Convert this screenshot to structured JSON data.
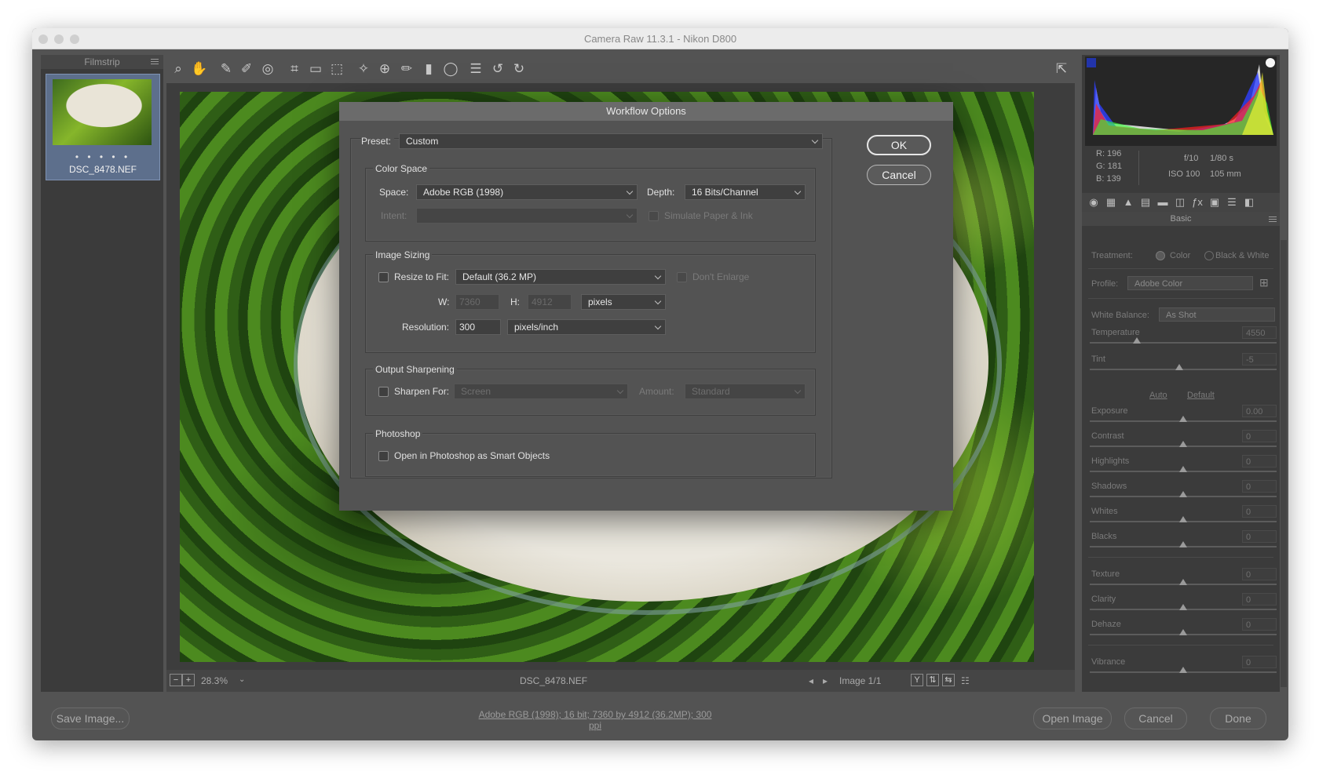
{
  "window": {
    "title": "Camera Raw 11.3.1  -  Nikon D800"
  },
  "filmstrip": {
    "header": "Filmstrip",
    "rating_dots": "• • • • •",
    "file_name": "DSC_8478.NEF"
  },
  "toolbar": {
    "tools": [
      "zoom-icon",
      "hand-icon",
      "white-balance-icon",
      "color-sampler-icon",
      "targeted-adjustment-icon",
      "crop-icon",
      "straighten-icon",
      "transform-icon",
      "spot-removal-icon",
      "red-eye-icon",
      "adjustment-brush-icon",
      "graduated-filter-icon",
      "radial-filter-icon",
      "presets-list-icon",
      "rotate-left-icon",
      "rotate-right-icon"
    ],
    "glyphs": [
      "⌕",
      "✋",
      "✎",
      "✐",
      "◎",
      "⌗",
      "▭",
      "⬚",
      "✧",
      "⊕",
      "✏",
      "▮",
      "◯",
      "☰",
      "↺",
      "↻"
    ],
    "fullscreen_icon": "⇱"
  },
  "status": {
    "zoom": "28.3%",
    "file_name": "DSC_8478.NEF",
    "image_count": "Image 1/1"
  },
  "histogram": {
    "readout": {
      "r": "R:  196",
      "g": "G:  181",
      "b": "B:  139",
      "aperture": "f/10",
      "shutter": "1/80 s",
      "iso": "ISO 100",
      "focal": "105 mm"
    }
  },
  "basic_panel": {
    "title": "Basic",
    "treatment_label": "Treatment:",
    "treatment_color": "Color",
    "treatment_bw": "Black & White",
    "profile_label": "Profile:",
    "profile_value": "Adobe Color",
    "wb_label": "White Balance:",
    "wb_value": "As Shot",
    "auto": "Auto",
    "default": "Default",
    "sliders": [
      {
        "label": "Temperature",
        "value": "4550",
        "position": 0.25
      },
      {
        "label": "Tint",
        "value": "-5",
        "position": 0.48
      },
      {
        "label": "Exposure",
        "value": "0.00",
        "position": 0.5
      },
      {
        "label": "Contrast",
        "value": "0",
        "position": 0.5
      },
      {
        "label": "Highlights",
        "value": "0",
        "position": 0.5
      },
      {
        "label": "Shadows",
        "value": "0",
        "position": 0.5
      },
      {
        "label": "Whites",
        "value": "0",
        "position": 0.5
      },
      {
        "label": "Blacks",
        "value": "0",
        "position": 0.5
      },
      {
        "label": "Texture",
        "value": "0",
        "position": 0.5
      },
      {
        "label": "Clarity",
        "value": "0",
        "position": 0.5
      },
      {
        "label": "Dehaze",
        "value": "0",
        "position": 0.5
      },
      {
        "label": "Vibrance",
        "value": "0",
        "position": 0.5
      }
    ]
  },
  "bottom": {
    "save_image": "Save Image...",
    "workflow_link": "Adobe RGB (1998); 16 bit; 7360 by 4912 (36.2MP); 300 ppi",
    "open_image": "Open Image",
    "cancel": "Cancel",
    "done": "Done"
  },
  "dialog": {
    "title": "Workflow Options",
    "preset_label": "Preset:",
    "preset_value": "Custom",
    "ok": "OK",
    "cancel": "Cancel",
    "color_space": {
      "title": "Color Space",
      "space_label": "Space:",
      "space_value": "Adobe RGB (1998)",
      "depth_label": "Depth:",
      "depth_value": "16 Bits/Channel",
      "intent_label": "Intent:",
      "intent_value": "",
      "simulate": "Simulate Paper & Ink"
    },
    "image_sizing": {
      "title": "Image Sizing",
      "resize_label": "Resize to Fit:",
      "resize_value": "Default  (36.2 MP)",
      "dont_enlarge": "Don't Enlarge",
      "w_label": "W:",
      "w_value": "7360",
      "h_label": "H:",
      "h_value": "4912",
      "units_value": "pixels",
      "resolution_label": "Resolution:",
      "resolution_value": "300",
      "resolution_units": "pixels/inch"
    },
    "output_sharpening": {
      "title": "Output Sharpening",
      "sharpen_label": "Sharpen For:",
      "sharpen_value": "Screen",
      "amount_label": "Amount:",
      "amount_value": "Standard"
    },
    "photoshop": {
      "title": "Photoshop",
      "smart_objects": "Open in Photoshop as Smart Objects"
    }
  },
  "colors": {
    "window_bg": "#535353",
    "panel_bg": "#3b3b3b",
    "dialog_bg": "#535353",
    "filmstrip_select": "#5d6f8c"
  }
}
